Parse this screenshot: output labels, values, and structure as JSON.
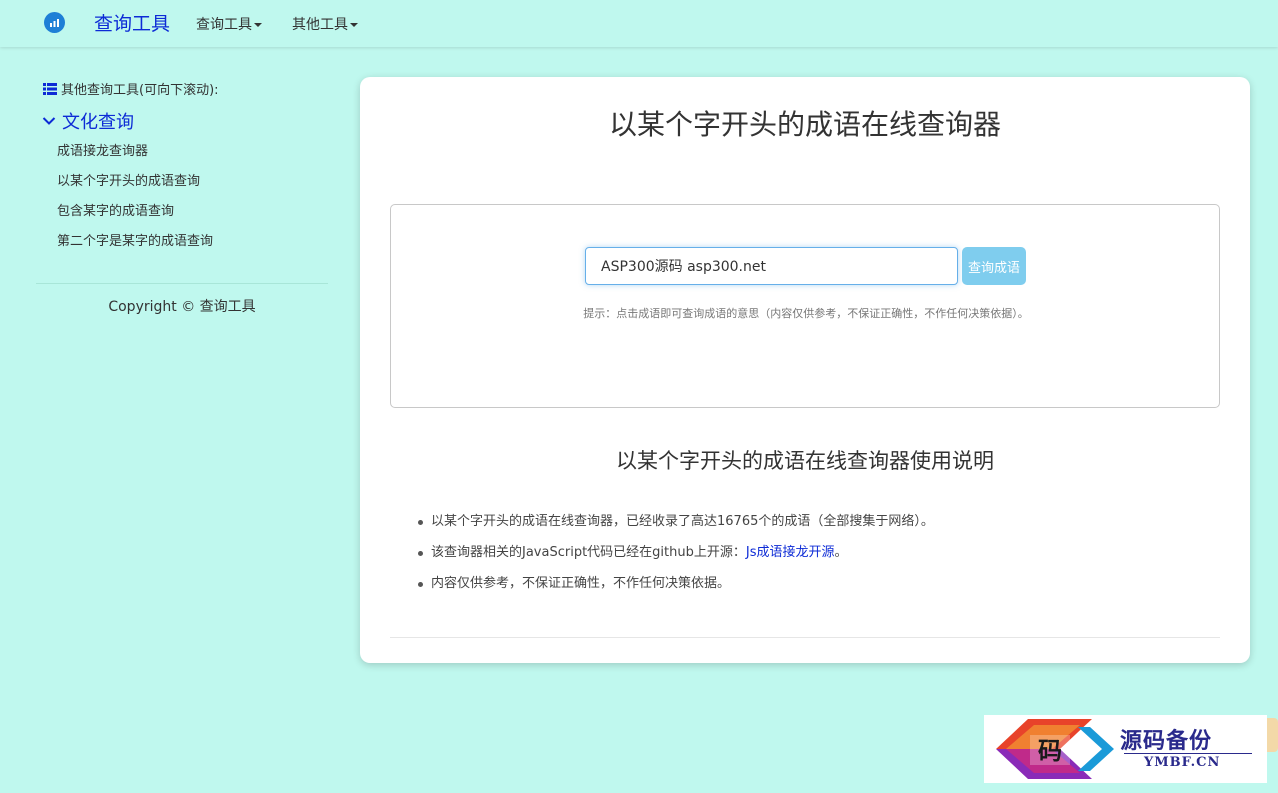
{
  "navbar": {
    "brand": "查询工具",
    "menu": [
      "查询工具",
      "其他工具"
    ]
  },
  "sidebar": {
    "header": "其他查询工具(可向下滚动):",
    "category": "文化查询",
    "links": [
      "成语接龙查询器",
      "以某个字开头的成语查询",
      "包含某字的成语查询",
      "第二个字是某字的成语查询"
    ],
    "copyright": "Copyright © 查询工具"
  },
  "main": {
    "title": "以某个字开头的成语在线查询器",
    "input_value": "ASP300源码 asp300.net",
    "button_label": "查询成语",
    "hint": "提示：点击成语即可查询成语的意思（内容仅供参考，不保证正确性，不作任何决策依据）。",
    "usage_title": "以某个字开头的成语在线查询器使用说明",
    "bullet1": "以某个字开头的成语在线查询器，已经收录了高达16765个的成语（全部搜集于网络）。",
    "bullet2_prefix": "该查询器相关的JavaScript代码已经在github上开源：",
    "bullet2_link": "Js成语接龙开源",
    "bullet2_suffix": "。",
    "bullet3": "内容仅供参考，不保证正确性，不作任何决策依据。"
  },
  "watermark": {
    "glyph": "码",
    "title": "源码备份",
    "domain": "YMBF.CN"
  },
  "colors": {
    "background": "#bff8ee",
    "link": "#0d2bd6",
    "button": "#7fcdee",
    "input_focus": "#66afe9"
  }
}
